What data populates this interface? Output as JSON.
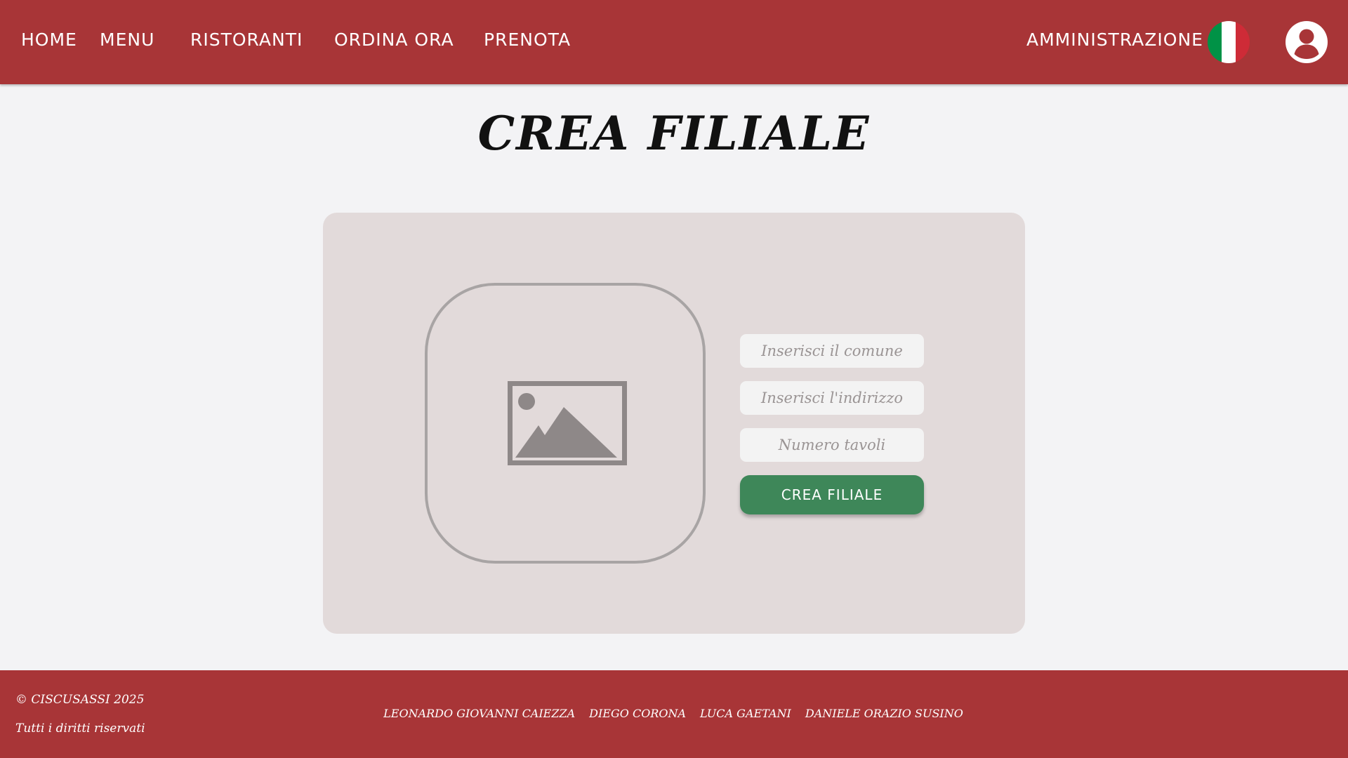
{
  "colors": {
    "brand_red": "#a83537",
    "background": "#f3f3f5",
    "card": "#e2dada",
    "button_green": "#3e8759",
    "flag_green": "#009246",
    "flag_white": "#ffffff",
    "flag_red": "#ce2b37"
  },
  "nav": {
    "home": "HOME",
    "menu": "MENU",
    "ristoranti": "RISTORANTI",
    "ordina": "ORDINA ORA",
    "prenota": "PRENOTA",
    "amministrazione": "AMMINISTRAZIONE",
    "language_icon": "italian-flag-icon",
    "user_icon": "user-circle-icon"
  },
  "main": {
    "title": "CREA FILIALE",
    "image_placeholder_icon": "image-placeholder-icon",
    "form": {
      "comune_placeholder": "Inserisci il comune",
      "indirizzo_placeholder": "Inserisci l'indirizzo",
      "tavoli_placeholder": "Numero tavoli",
      "submit_label": "CREA FILIALE"
    }
  },
  "footer": {
    "copyright": "© CISCUSASSI 2025",
    "rights": "Tutti i diritti riservati",
    "authors": [
      "LEONARDO GIOVANNI CAIEZZA",
      "DIEGO CORONA",
      "LUCA GAETANI",
      "DANIELE ORAZIO SUSINO"
    ]
  }
}
